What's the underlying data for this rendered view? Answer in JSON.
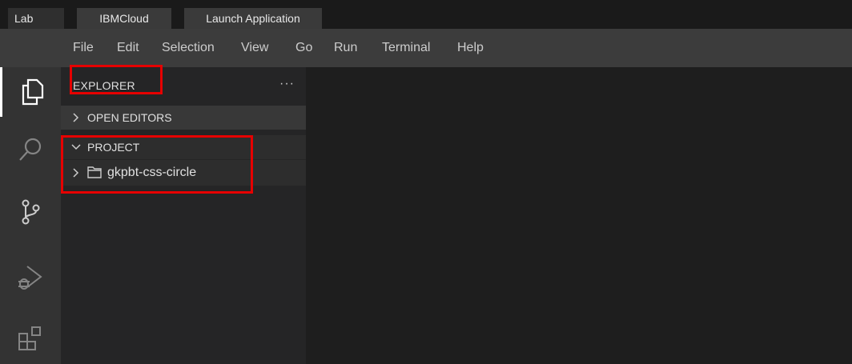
{
  "lab_tabs": [
    "Lab",
    "IBMCloud",
    "Launch Application"
  ],
  "menu": [
    "File",
    "Edit",
    "Selection",
    "View",
    "Go",
    "Run",
    "Terminal",
    "Help"
  ],
  "activity": {
    "items": [
      "explorer-icon",
      "search-icon",
      "source-control-icon",
      "run-debug-icon",
      "extensions-icon"
    ]
  },
  "sidebar": {
    "title": "EXPLORER",
    "more_actions": "···",
    "sections": [
      {
        "label": "OPEN EDITORS",
        "expanded": false
      },
      {
        "label": "PROJECT",
        "expanded": true
      }
    ],
    "tree": [
      {
        "label": "gkpbt-css-circle",
        "type": "folder",
        "expanded": false
      }
    ]
  },
  "colors": {
    "highlight": "#e60000",
    "menubar": "#3c3c3c",
    "activitybar": "#333333",
    "sidebar": "#252526",
    "editor": "#1e1e1e"
  }
}
